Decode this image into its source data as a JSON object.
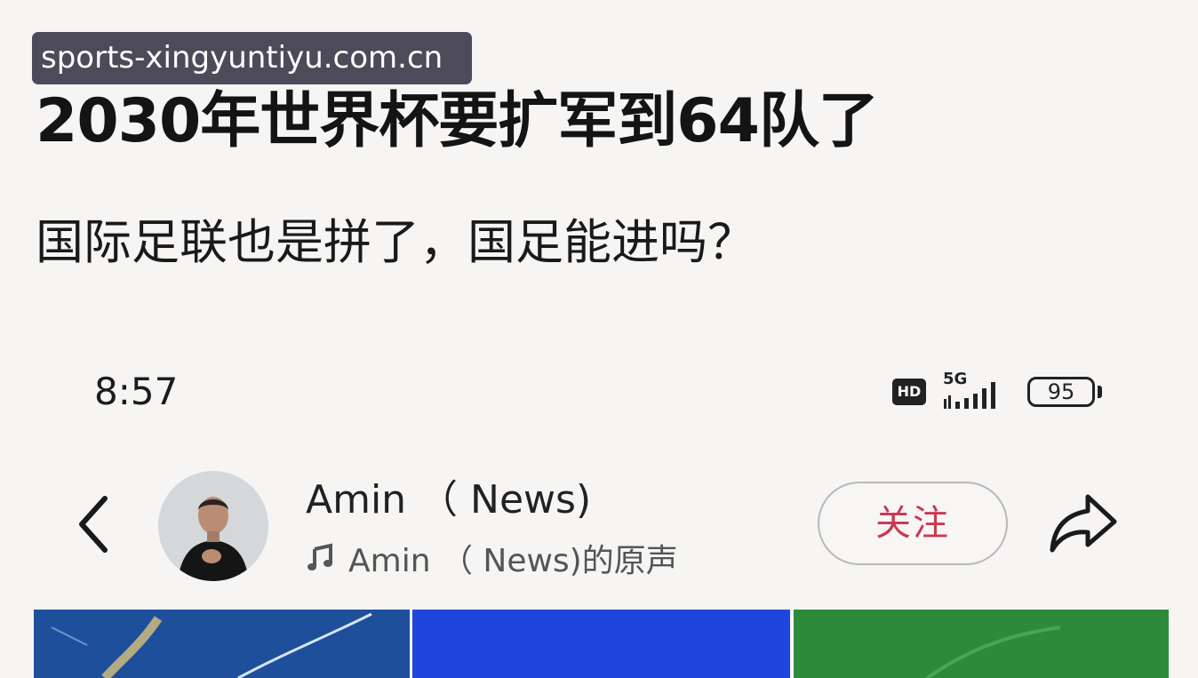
{
  "watermark": {
    "text": "sports-xingyuntiyu.com.cn"
  },
  "post": {
    "headline": "2030年世界杯要扩军到64队了",
    "subline": "国际足联也是拼了，国足能进吗？"
  },
  "status_bar": {
    "time": "8:57",
    "hd": "HD",
    "network": "5G",
    "battery": "95"
  },
  "author": {
    "name": "Amin （ News)",
    "sound": "Amin （ News)的原声"
  },
  "actions": {
    "follow_label": "关注"
  },
  "icons": {
    "back": "chevron-left-icon",
    "music": "music-note-icon",
    "share": "share-arrow-icon"
  },
  "colors": {
    "follow_text": "#c93a52",
    "thumbnail_1": "#1d4f9a",
    "thumbnail_2": "#1f46dc",
    "thumbnail_3": "#2d8a3a"
  }
}
